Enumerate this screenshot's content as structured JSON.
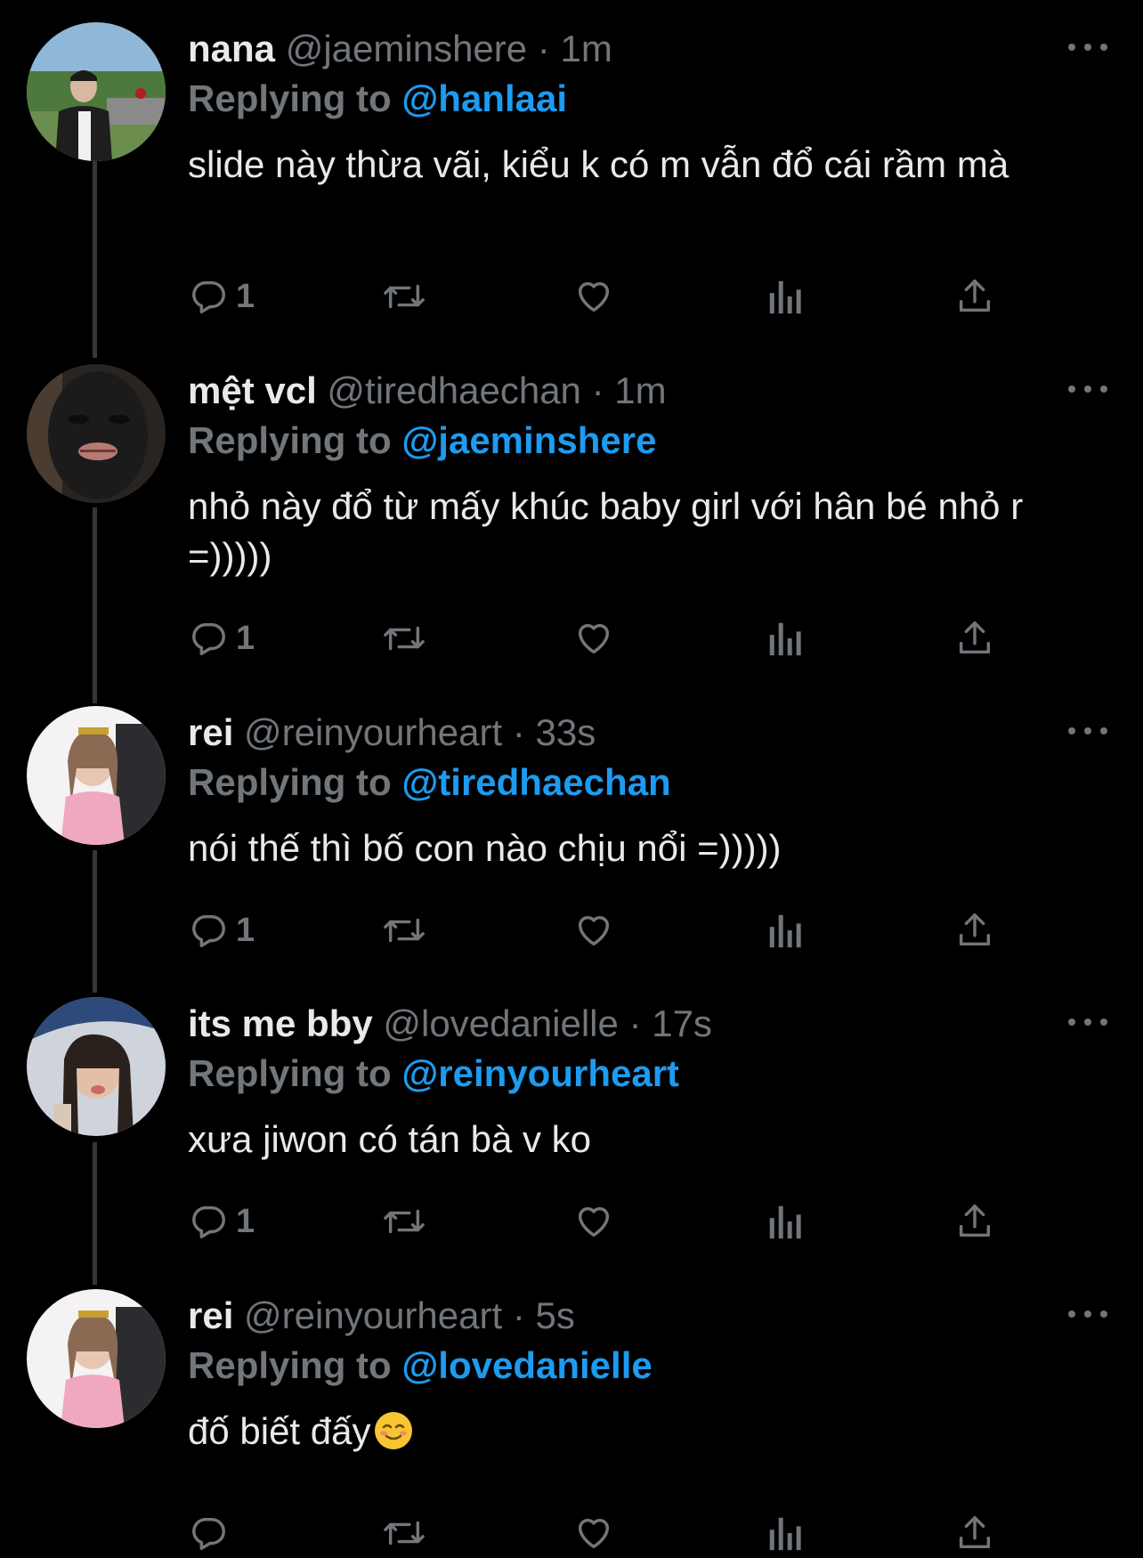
{
  "tweets": [
    {
      "name": "nana",
      "handle": "@jaeminshere",
      "dot": "·",
      "time": "1m",
      "reply_prefix": "Replying to",
      "reply_to": "@hanlaai",
      "text": "slide này thừa vãi, kiểu k có m vẫn đổ cái rầm mà",
      "reply_count": "1"
    },
    {
      "name": "mệt vcl",
      "handle": "@tiredhaechan",
      "dot": "·",
      "time": "1m",
      "reply_prefix": "Replying to",
      "reply_to": "@jaeminshere",
      "text": "nhỏ này đổ từ mấy khúc baby girl với hân bé nhỏ r =)))))",
      "reply_count": "1"
    },
    {
      "name": "rei",
      "handle": "@reinyourheart",
      "dot": "·",
      "time": "33s",
      "reply_prefix": "Replying to",
      "reply_to": "@tiredhaechan",
      "text": "nói thế thì bố con nào chịu nổi =)))))",
      "reply_count": "1"
    },
    {
      "name": "its me bby",
      "handle": "@lovedanielle",
      "dot": "·",
      "time": "17s",
      "reply_prefix": "Replying to",
      "reply_to": "@reinyourheart",
      "text": "xưa jiwon có tán bà v ko",
      "reply_count": "1"
    },
    {
      "name": "rei",
      "handle": "@reinyourheart",
      "dot": "·",
      "time": "5s",
      "reply_prefix": "Replying to",
      "reply_to": "@lovedanielle",
      "text": "đố biết đấy",
      "reply_count": ""
    }
  ],
  "icons": {
    "reply": "reply-icon",
    "retweet": "retweet-icon",
    "like": "heart-icon",
    "views": "views-icon",
    "share": "share-icon",
    "more": "more-icon"
  },
  "colors": {
    "background": "#000000",
    "text": "#e7e9ea",
    "secondary": "#71767b",
    "link": "#1d9bf0"
  }
}
